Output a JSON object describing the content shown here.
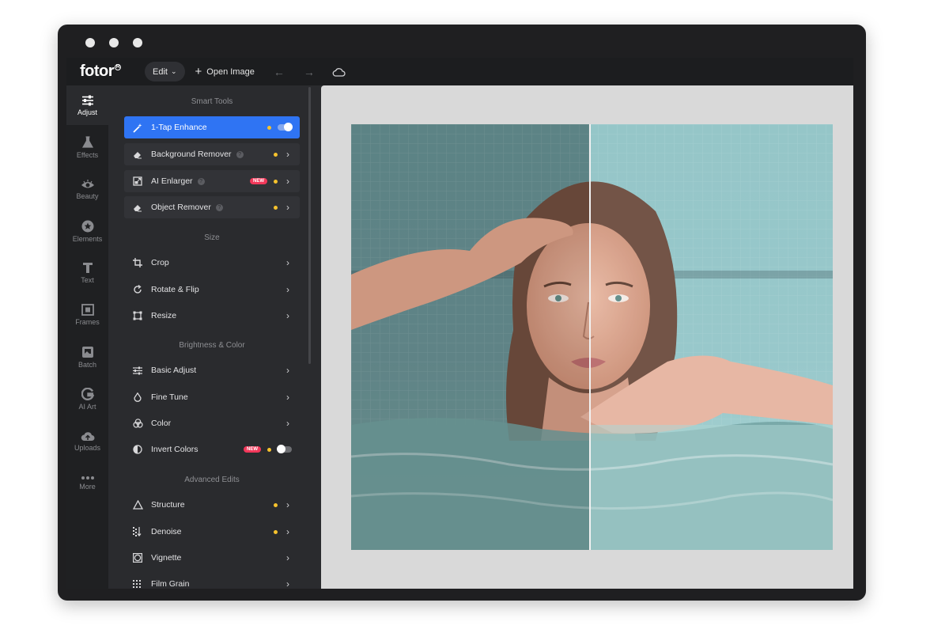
{
  "app": {
    "logo": "fotor",
    "logo_mark": "R"
  },
  "topbar": {
    "edit_label": "Edit",
    "open_image_label": "Open Image"
  },
  "rail": [
    {
      "label": "Adjust",
      "icon": "sliders-icon",
      "active": true
    },
    {
      "label": "Effects",
      "icon": "flask-icon"
    },
    {
      "label": "Beauty",
      "icon": "eye-icon"
    },
    {
      "label": "Elements",
      "icon": "star-icon"
    },
    {
      "label": "Text",
      "icon": "text-icon"
    },
    {
      "label": "Frames",
      "icon": "frame-icon"
    },
    {
      "label": "Batch",
      "icon": "batch-icon"
    },
    {
      "label": "AI Art",
      "icon": "ai-art-icon"
    },
    {
      "label": "Uploads",
      "icon": "cloud-upload-icon"
    },
    {
      "label": "More",
      "icon": "more-icon"
    }
  ],
  "sections": {
    "smart_tools": "Smart Tools",
    "size": "Size",
    "brightness_color": "Brightness & Color",
    "advanced_edits": "Advanced Edits"
  },
  "tools": {
    "one_tap_enhance": "1-Tap Enhance",
    "background_remover": "Background Remover",
    "ai_enlarger": "AI Enlarger",
    "object_remover": "Object Remover",
    "crop": "Crop",
    "rotate_flip": "Rotate & Flip",
    "resize": "Resize",
    "basic_adjust": "Basic Adjust",
    "fine_tune": "Fine Tune",
    "color": "Color",
    "invert_colors": "Invert Colors",
    "structure": "Structure",
    "denoise": "Denoise",
    "vignette": "Vignette",
    "film_grain": "Film Grain"
  },
  "badges": {
    "new": "NEW"
  },
  "colors": {
    "accent": "#2f74f3",
    "premium_dot": "#f6c22d",
    "new_badge": "#f2385a"
  }
}
